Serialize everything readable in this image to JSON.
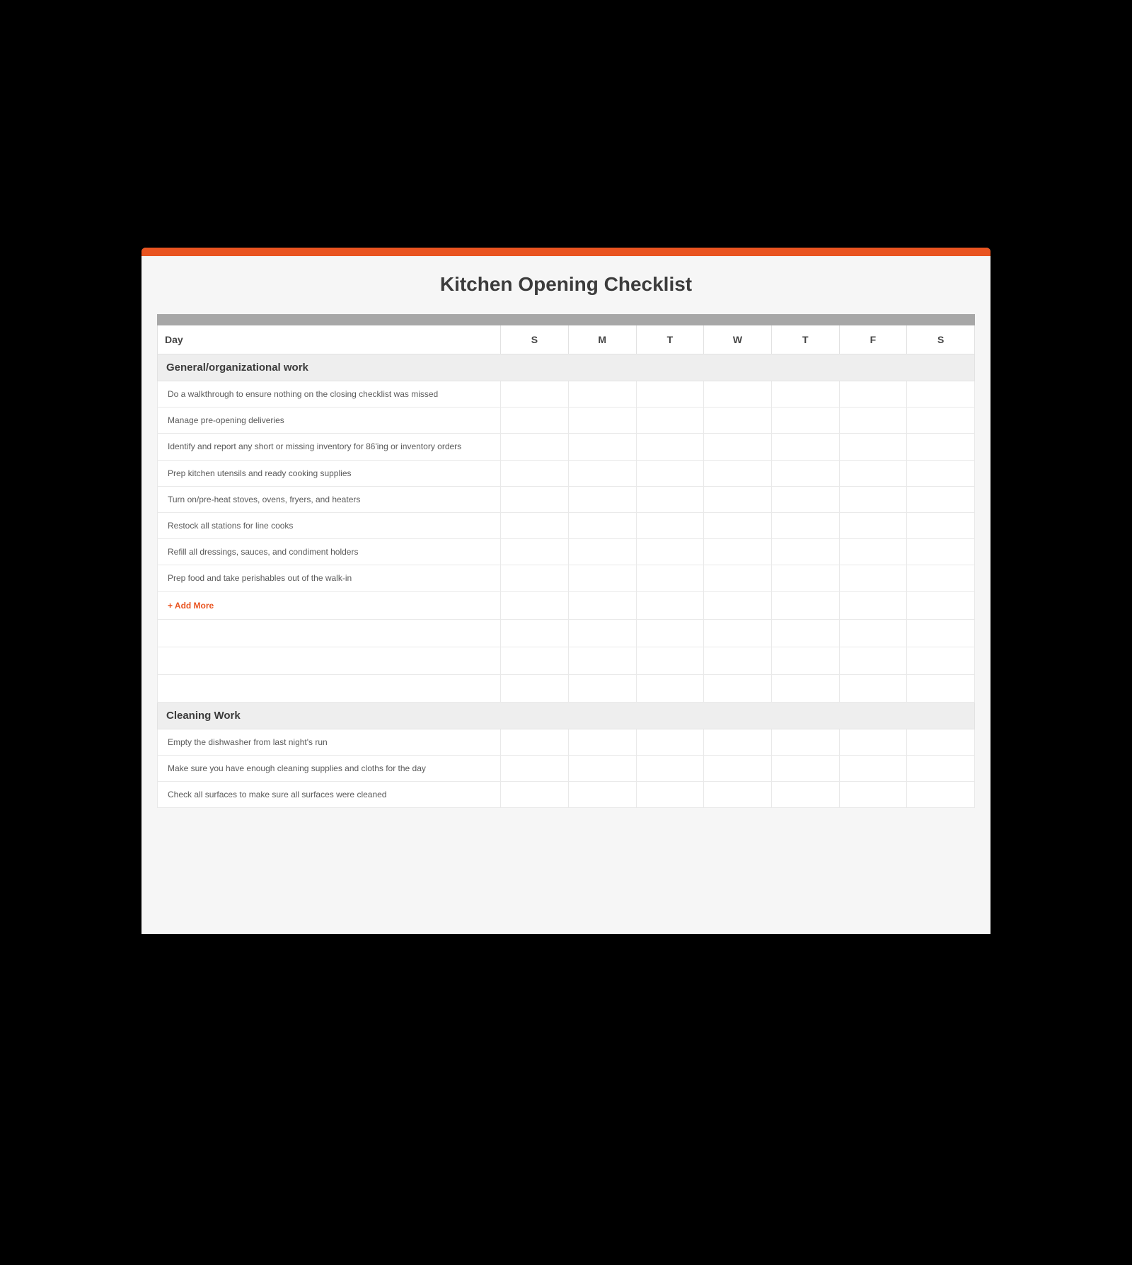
{
  "title": "Kitchen Opening Checklist",
  "accent_color": "#e95420",
  "header": {
    "label": "Day",
    "days": [
      "S",
      "M",
      "T",
      "W",
      "T",
      "F",
      "S"
    ]
  },
  "add_more_label": "+ Add More",
  "sections": [
    {
      "name": "General/organizational work",
      "tasks": [
        "Do a walkthrough to ensure nothing on the closing checklist was missed",
        "Manage pre-opening deliveries",
        "Identify and report any short or missing inventory for 86'ing or inventory orders",
        "Prep kitchen utensils and ready cooking supplies",
        "Turn on/pre-heat stoves, ovens, fryers, and heaters",
        "Restock all stations for line cooks",
        "Refill all dressings, sauces, and condiment holders",
        "Prep food and take perishables out of the walk-in"
      ],
      "show_add_more": true,
      "trailing_blank_rows": 3
    },
    {
      "name": "Cleaning Work",
      "tasks": [
        "Empty the dishwasher from last night's run",
        "Make sure you have enough cleaning supplies and cloths for the day",
        "Check all surfaces to make sure all surfaces were cleaned"
      ],
      "show_add_more": false,
      "trailing_blank_rows": 0
    }
  ]
}
